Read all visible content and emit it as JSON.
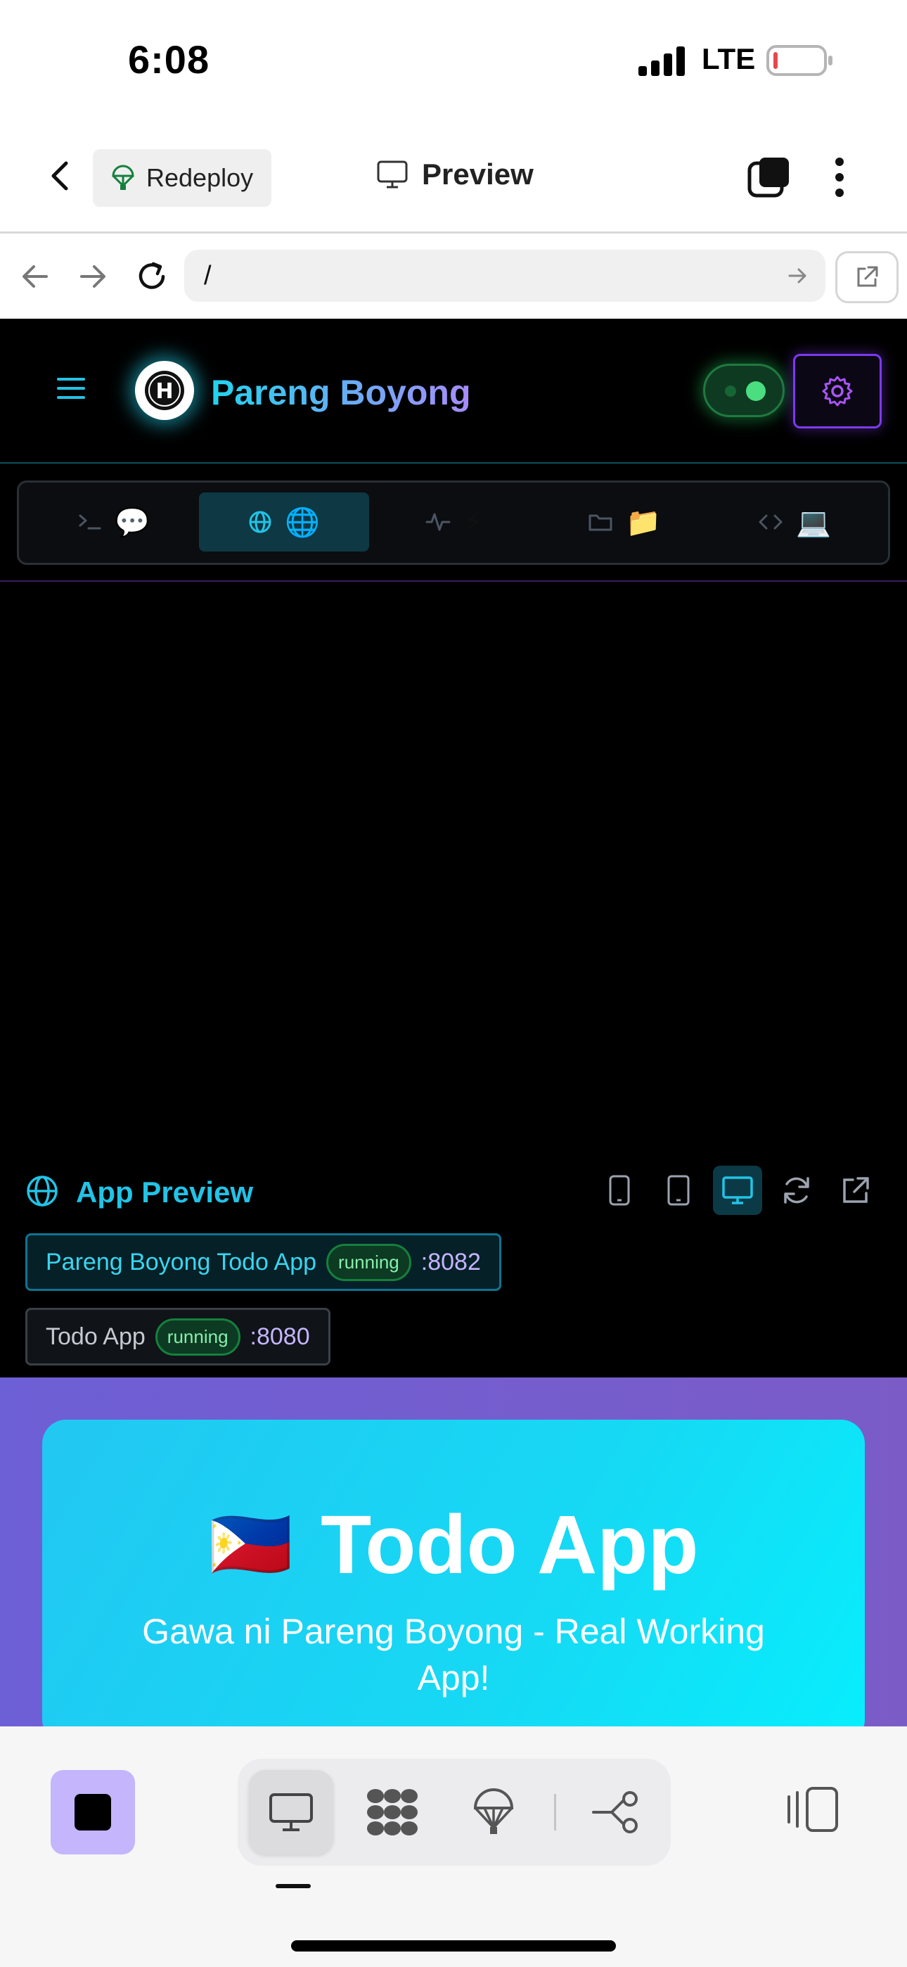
{
  "status_bar": {
    "time": "6:08",
    "network": "LTE"
  },
  "header": {
    "redeploy_label": "Redeploy",
    "title": "Preview"
  },
  "url_bar": {
    "path": "/"
  },
  "app": {
    "brand": "Pareng Boyong",
    "logo_text": "H",
    "tabs": [
      {
        "icon": "terminal-icon",
        "emoji": "💬",
        "active": false
      },
      {
        "icon": "globe-icon",
        "emoji": "🌐",
        "active": true
      },
      {
        "icon": "activity-icon",
        "emoji": "⚡",
        "active": false
      },
      {
        "icon": "folder-icon",
        "emoji": "📁",
        "active": false
      },
      {
        "icon": "code-icon",
        "emoji": "💻",
        "active": false
      }
    ],
    "preview_label": "App Preview",
    "apps": [
      {
        "name": "Pareng Boyong Todo App",
        "status": "running",
        "port": ":8082"
      },
      {
        "name": "Todo App",
        "status": "running",
        "port": ":8080"
      }
    ]
  },
  "web": {
    "flag": "🇵🇭",
    "title": "Todo App",
    "subtitle": "Gawa ni Pareng Boyong - Real Working App!"
  },
  "colors": {
    "accent_cyan": "#22d3ee",
    "accent_purple": "#a78bfa",
    "running_green": "#4ade80",
    "stop_button": "#c4b5fd"
  }
}
